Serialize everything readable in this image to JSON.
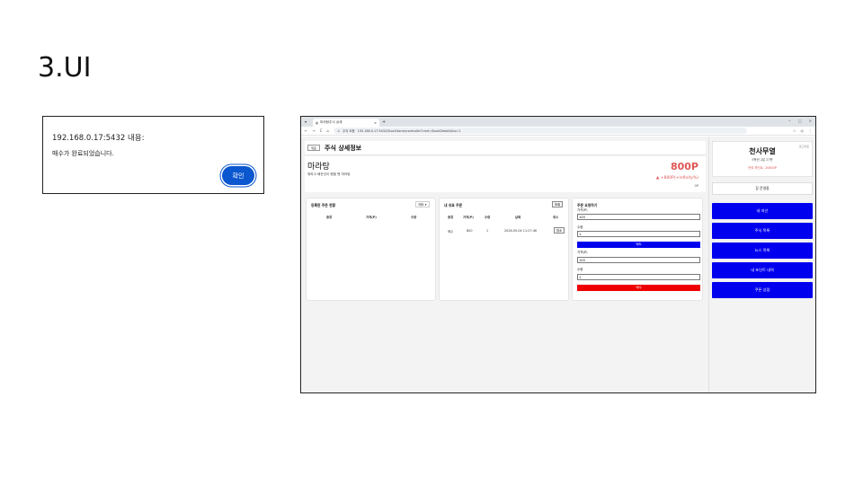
{
  "slide": {
    "title": "3.UI"
  },
  "alert": {
    "origin": "192.168.0.17:5432 내용:",
    "message": "매수가 완료되었습니다.",
    "ok_label": "확인"
  },
  "browser": {
    "tab_title": "마라탕주식 상세",
    "tab_close": "×",
    "new_tab": "+",
    "nav": {
      "back": "←",
      "forward": "→",
      "reload": "C",
      "home": "⌂"
    },
    "security_label": "주의 요함",
    "url": "192.168.0.17:5432/StockGame/controller?cmd=StockDetail&fno=1",
    "window_controls": [
      "−",
      "□",
      "×"
    ],
    "toolbar_icons": [
      "☆",
      "◎",
      "⋮"
    ]
  },
  "page": {
    "back_label": "뒤로",
    "detail_title": "주식 상세정보",
    "stock": {
      "name": "마라탕",
      "description": "뭐하고 배운것이 됐을 땐 마라탕",
      "price": "800P",
      "change": "▲ +800P(+Infinity%)",
      "base": "0P"
    },
    "holdings": {
      "title": "등록된 주문 현황",
      "sort_label": "매도 ▾",
      "columns": [
        "종류",
        "가격(P)",
        "수량"
      ]
    },
    "my_orders": {
      "title": "내 유효 주문",
      "search_label": "조회",
      "columns": [
        "종류",
        "가격(P)",
        "수량",
        "날짜",
        "취소"
      ],
      "rows": [
        {
          "type": "매수",
          "price": "800",
          "qty": "1",
          "date": "2026-05-04 11:27:46",
          "cancel": "취소"
        }
      ]
    },
    "order_form": {
      "title": "주문 요청하기",
      "sell": {
        "price_label": "가격(P)",
        "price_value": "100",
        "qty_label": "수량",
        "qty_value": "1",
        "button": "매도"
      },
      "buy": {
        "price_label": "가격(P)",
        "price_value": "100",
        "qty_label": "수량",
        "qty_value": "1",
        "button": "매수"
      }
    }
  },
  "sidebar": {
    "logout": "로그아웃",
    "user_name": "천사무열",
    "time": "5학년 2분 27판",
    "points": "잔여 포인트: 20800P",
    "long_label": "장 운영중",
    "nav": [
      "내 자산",
      "주식 목록",
      "뉴스 목록",
      "내 포인트 내역",
      "쿠폰 상점"
    ]
  },
  "colors": {
    "nav_blue": "#0000ee",
    "sell_blue": "#0000ee",
    "buy_red": "#ee0000",
    "price_red": "#e05555",
    "ok_button": "#0b57d0"
  }
}
